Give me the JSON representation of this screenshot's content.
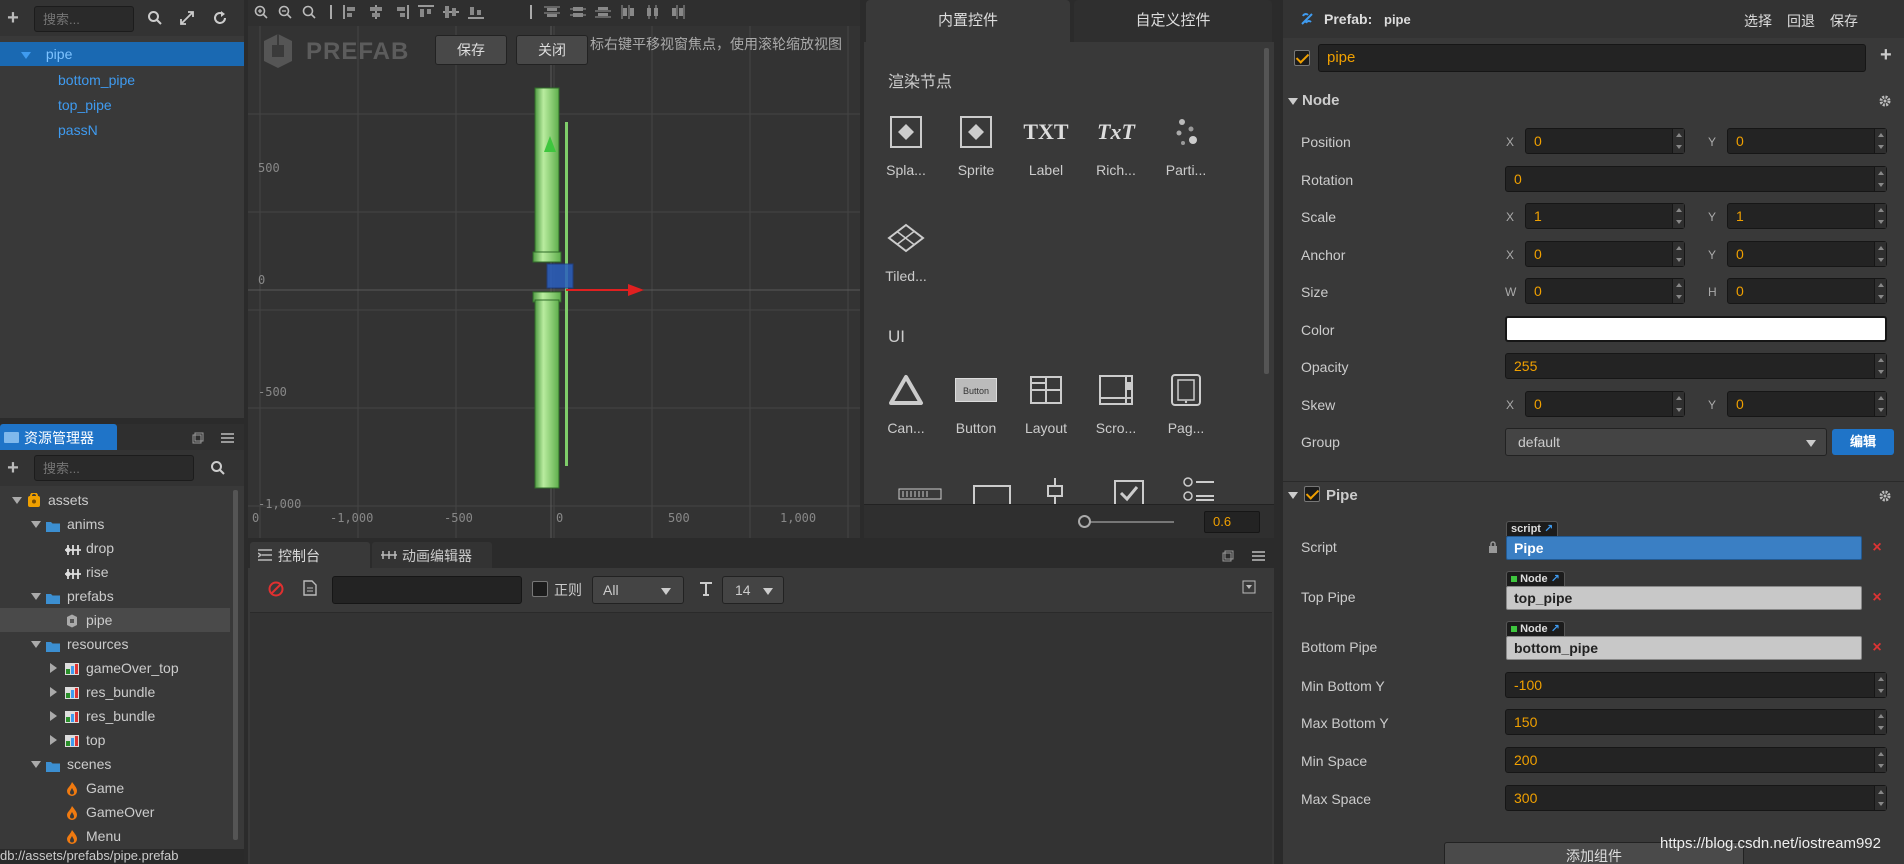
{
  "hierarchy": {
    "search_placeholder": "搜索...",
    "nodes": [
      {
        "label": "pipe",
        "selected": true
      },
      {
        "label": "bottom_pipe"
      },
      {
        "label": "top_pipe"
      },
      {
        "label": "passN"
      }
    ]
  },
  "assets": {
    "tab_label": "资源管理器",
    "search_placeholder": "搜索...",
    "tree": [
      {
        "label": "assets",
        "kind": "db"
      },
      {
        "label": "anims",
        "kind": "folder"
      },
      {
        "label": "drop",
        "kind": "anim"
      },
      {
        "label": "rise",
        "kind": "anim"
      },
      {
        "label": "prefabs",
        "kind": "folder"
      },
      {
        "label": "pipe",
        "kind": "prefab"
      },
      {
        "label": "resources",
        "kind": "folder"
      },
      {
        "label": "gameOver_top",
        "kind": "sprite"
      },
      {
        "label": "res_bundle",
        "kind": "sprite"
      },
      {
        "label": "res_bundle",
        "kind": "sprite"
      },
      {
        "label": "top",
        "kind": "sprite"
      },
      {
        "label": "scenes",
        "kind": "folder"
      },
      {
        "label": "Game",
        "kind": "scene"
      },
      {
        "label": "GameOver",
        "kind": "scene"
      },
      {
        "label": "Menu",
        "kind": "scene"
      }
    ],
    "status_path": "db://assets/prefabs/pipe.prefab"
  },
  "scene": {
    "prefab_watermark": "PREFAB",
    "save_label": "保存",
    "close_label": "关闭",
    "hint": "标右键平移视窗焦点，使用滚轮缩放视图",
    "y_ticks": [
      "500",
      "0",
      "-500",
      "-1,000"
    ],
    "x_ticks": [
      "0",
      "-1,000",
      "-500",
      "0",
      "500",
      "1,000"
    ]
  },
  "controls": {
    "tab_builtin": "内置控件",
    "tab_custom": "自定义控件",
    "section_render": "渲染节点",
    "render_items": [
      "Spla...",
      "Sprite",
      "Label",
      "Rich...",
      "Parti...",
      "Tiled..."
    ],
    "section_ui": "UI",
    "ui_items": [
      "Can...",
      "Button",
      "Layout",
      "Scro...",
      "Pag..."
    ],
    "button_icon_text": "Button",
    "txt_icon_1": "TXT",
    "txt_icon_2": "TxT",
    "zoom_value": "0.6"
  },
  "console": {
    "tab_console": "控制台",
    "tab_anim": "动画编辑器",
    "regex_label": "正则",
    "level_select": "All",
    "font_size": "14"
  },
  "inspector": {
    "header_prefix": "Prefab:",
    "header_name": "pipe",
    "btn_select": "选择",
    "btn_revert": "回退",
    "btn_save": "保存",
    "node_name": "pipe",
    "node_section": "Node",
    "props": {
      "position": {
        "label": "Position",
        "x": "0",
        "y": "0"
      },
      "rotation": {
        "label": "Rotation",
        "value": "0"
      },
      "scale": {
        "label": "Scale",
        "x": "1",
        "y": "1"
      },
      "anchor": {
        "label": "Anchor",
        "x": "0",
        "y": "0"
      },
      "size": {
        "label": "Size",
        "w": "0",
        "h": "0"
      },
      "color": {
        "label": "Color",
        "value": "#ffffff"
      },
      "opacity": {
        "label": "Opacity",
        "value": "255"
      },
      "skew": {
        "label": "Skew",
        "x": "0",
        "y": "0"
      },
      "group": {
        "label": "Group",
        "value": "default",
        "edit": "编辑"
      }
    },
    "axis": {
      "x": "X",
      "y": "Y",
      "w": "W",
      "h": "H"
    },
    "pipe_section": "Pipe",
    "pipe_props": {
      "script": {
        "label": "Script",
        "tag": "script",
        "value": "Pipe"
      },
      "top_pipe": {
        "label": "Top Pipe",
        "tag": "Node",
        "value": "top_pipe"
      },
      "bottom_pipe": {
        "label": "Bottom Pipe",
        "tag": "Node",
        "value": "bottom_pipe"
      },
      "min_bottom_y": {
        "label": "Min Bottom Y",
        "value": "-100"
      },
      "max_bottom_y": {
        "label": "Max Bottom Y",
        "value": "150"
      },
      "min_space": {
        "label": "Min Space",
        "value": "200"
      },
      "max_space": {
        "label": "Max Space",
        "value": "300"
      }
    },
    "add_component": "添加组件",
    "watermark": "https://blog.csdn.net/iostream992"
  },
  "colors": {
    "accent": "#f0a000",
    "selection": "#1a69b2",
    "link": "#3f9bf0",
    "pipe_green": "#7fcc6a",
    "script_ref": "#3a7fc4",
    "edit_btn": "#1f74c8"
  }
}
